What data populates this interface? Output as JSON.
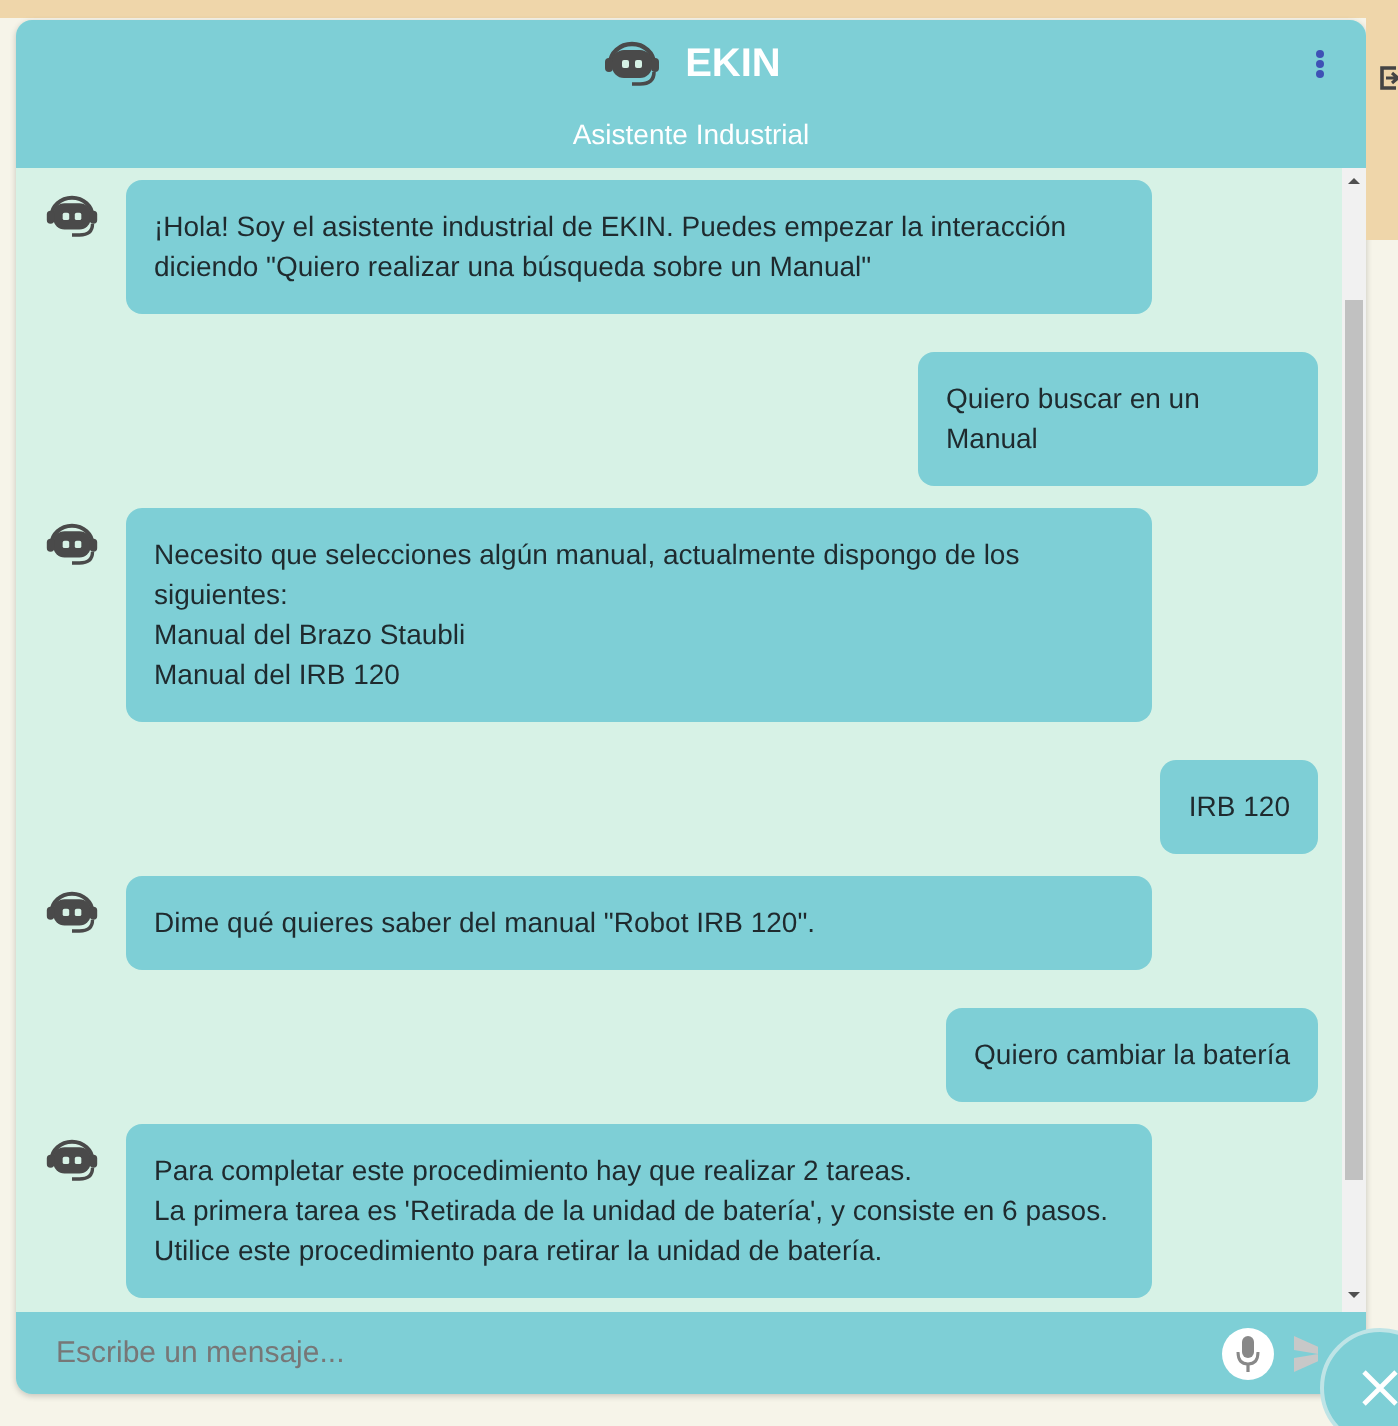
{
  "header": {
    "title": "EKIN",
    "subtitle": "Asistente Industrial"
  },
  "messages": [
    {
      "kind": "bot",
      "text": "¡Hola! Soy el asistente industrial de EKIN. Puedes empezar la interacción diciendo \"Quiero realizar una búsqueda sobre un Manual\""
    },
    {
      "kind": "user",
      "text": "Quiero buscar en un Manual"
    },
    {
      "kind": "bot",
      "text": "Necesito que selecciones algún manual, actualmente dispongo de los siguientes:\nManual del Brazo Staubli\nManual del IRB 120"
    },
    {
      "kind": "user",
      "text": "IRB 120"
    },
    {
      "kind": "bot",
      "text": "Dime qué quieres saber del manual \"Robot IRB 120\"."
    },
    {
      "kind": "user",
      "text": "Quiero cambiar la batería"
    },
    {
      "kind": "bot",
      "text": "Para completar este procedimiento hay que realizar 2 tareas.\nLa primera tarea es 'Retirada de la unidad de batería', y consiste en 6 pasos.\nUtilice este procedimiento para retirar la unidad de batería."
    }
  ],
  "composer": {
    "placeholder": "Escribe un mensaje..."
  }
}
